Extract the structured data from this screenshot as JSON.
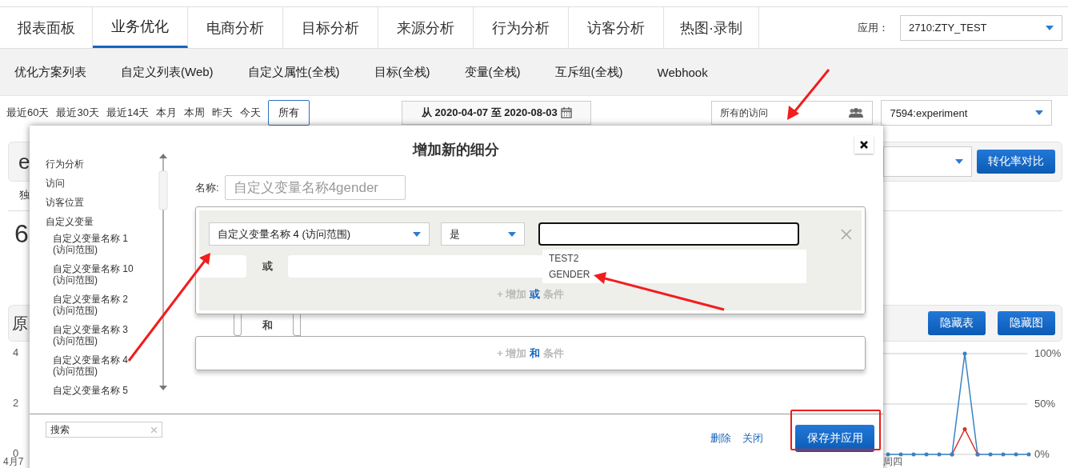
{
  "top_nav": {
    "tabs": [
      {
        "label": "报表面板",
        "selected": false
      },
      {
        "label": "业务优化",
        "selected": true
      },
      {
        "label": "电商分析",
        "selected": false
      },
      {
        "label": "目标分析",
        "selected": false
      },
      {
        "label": "来源分析",
        "selected": false
      },
      {
        "label": "行为分析",
        "selected": false
      },
      {
        "label": "访客分析",
        "selected": false
      },
      {
        "label": "热图·录制",
        "selected": false
      }
    ],
    "app_label": "应用：",
    "app_select": "2710:ZTY_TEST"
  },
  "sub_nav": {
    "items": [
      "优化方案列表",
      "自定义列表(Web)",
      "自定义属性(全栈)",
      "目标(全栈)",
      "变量(全栈)",
      "互斥组(全栈)",
      "Webhook"
    ]
  },
  "filter_bar": {
    "ranges": [
      {
        "label": "最近60天",
        "selected": false
      },
      {
        "label": "最近30天",
        "selected": false
      },
      {
        "label": "最近14天",
        "selected": false
      },
      {
        "label": "本月",
        "selected": false
      },
      {
        "label": "本周",
        "selected": false
      },
      {
        "label": "昨天",
        "selected": false
      },
      {
        "label": "今天",
        "selected": false
      },
      {
        "label": "所有",
        "selected": true
      }
    ],
    "date_range": "从 2020-04-07 至 2020-08-03",
    "segment": "所有的访问",
    "experiment": "7594:experiment"
  },
  "background": {
    "card_title": "e",
    "tab_fragment": "独",
    "metric_fragment": "6",
    "section_title": "原",
    "compare_button": "转化率对比",
    "hide_table_button": "隐藏表",
    "hide_chart_button": "隐藏图",
    "chart": {
      "left_ticks": [
        "4",
        "2",
        "0"
      ],
      "x_label_left": "4月7",
      "x_label_right": "周四",
      "chart_data": {
        "type": "line",
        "ylim": [
          0,
          100
        ],
        "yticks": [
          {
            "value": 100,
            "label": "100%"
          },
          {
            "value": 50,
            "label": "50%"
          },
          {
            "value": 0,
            "label": "0%"
          }
        ],
        "series": [
          {
            "color": "#3b82c4",
            "values": [
              0,
              0,
              0,
              0,
              0,
              0,
              100,
              0,
              0,
              0,
              0,
              0
            ]
          },
          {
            "color": "#d9302c",
            "values": [
              null,
              null,
              null,
              null,
              null,
              0,
              25,
              0,
              null,
              null,
              null,
              null
            ]
          }
        ]
      }
    }
  },
  "modal": {
    "title": "增加新的细分",
    "sidebar": [
      {
        "label": "行为分析"
      },
      {
        "label": "访问"
      },
      {
        "label": "访客位置"
      },
      {
        "label": "自定义变量",
        "children": [
          {
            "label": "自定义变量名称 1 (访问范围)"
          },
          {
            "label": "自定义变量名称 10 (访问范围)"
          },
          {
            "label": "自定义变量名称 2 (访问范围)"
          },
          {
            "label": "自定义变量名称 3 (访问范围)"
          },
          {
            "label": "自定义变量名称 4 (访问范围)"
          },
          {
            "label": "自定义变量名称 5"
          }
        ]
      }
    ],
    "search": {
      "placeholder": "搜索"
    },
    "name_label": "名称:",
    "name_value": "自定义变量名称4gender",
    "condition": {
      "field": "自定义变量名称 4 (访问范围)",
      "operator": "是",
      "suggestions": [
        "TEST2",
        "GENDER"
      ],
      "or_label": "或",
      "add_or": "+ 增加 **或** 条件"
    },
    "and_label": "和",
    "add_and": "+ 增加 **和** 条件",
    "delete_link": "删除",
    "close_link": "关闭",
    "save_button": "保存并应用"
  }
}
